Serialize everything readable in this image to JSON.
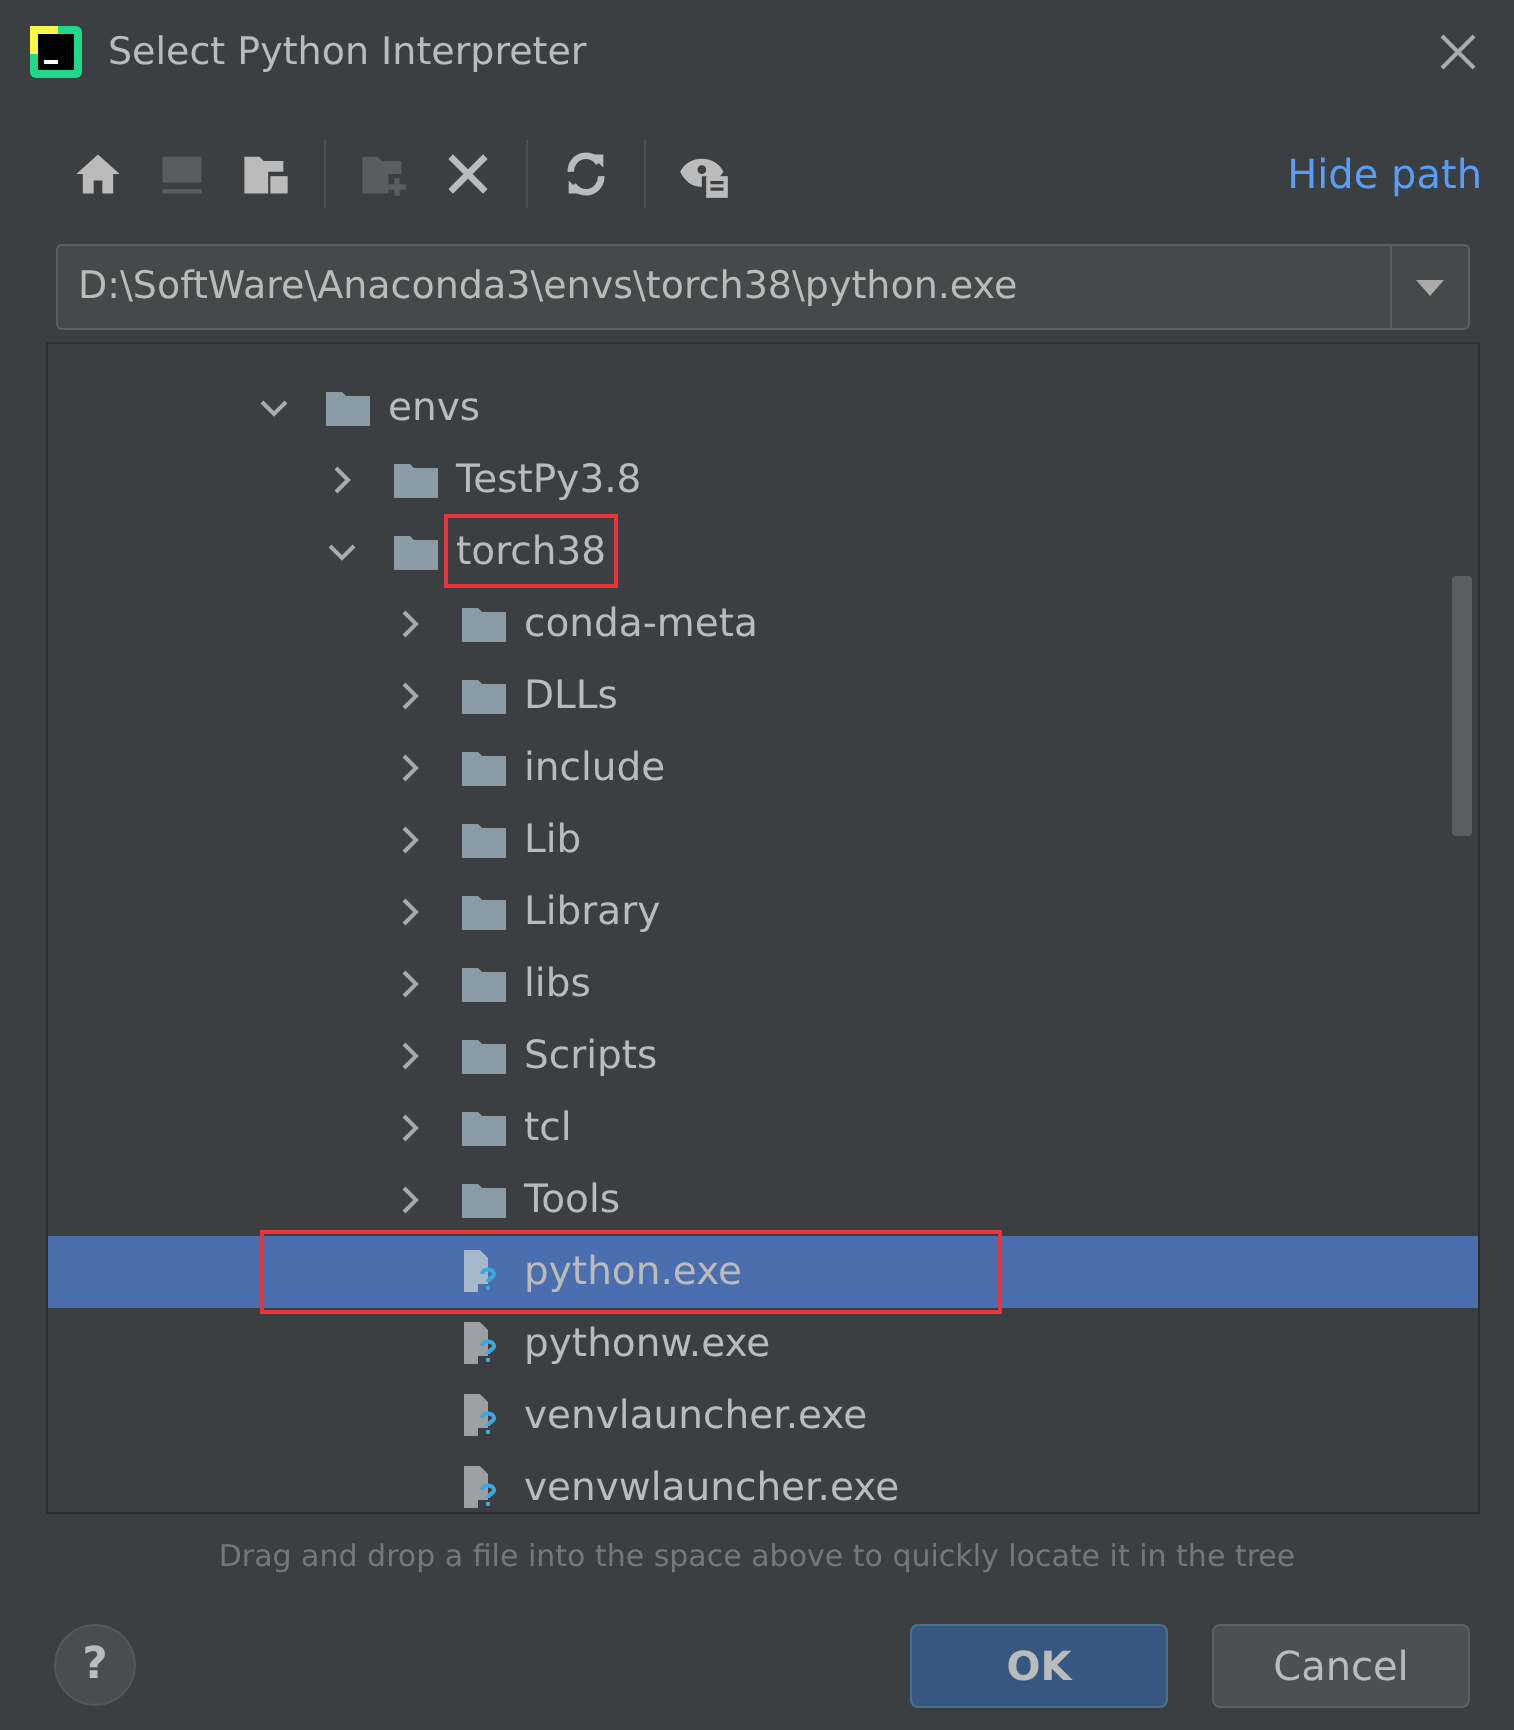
{
  "window": {
    "title": "Select Python Interpreter"
  },
  "toolbar": {
    "groups": [
      [
        {
          "kind": "home",
          "disabled": false
        },
        {
          "kind": "desktop",
          "disabled": true
        },
        {
          "kind": "project",
          "disabled": false
        }
      ],
      [
        {
          "kind": "new-folder",
          "disabled": true
        },
        {
          "kind": "delete",
          "disabled": false
        }
      ],
      [
        {
          "kind": "refresh",
          "disabled": false
        }
      ],
      [
        {
          "kind": "show-hidden",
          "disabled": false
        }
      ]
    ],
    "hide_path": "Hide path"
  },
  "path_field": {
    "value": "D:\\SoftWare\\Anaconda3\\envs\\torch38\\python.exe"
  },
  "tree": [
    {
      "label": "envs",
      "kind": "folder",
      "expanded": true,
      "selected": false,
      "highlighted": false,
      "children": [
        {
          "label": "TestPy3.8",
          "kind": "folder",
          "expanded": false,
          "selected": false,
          "highlighted": false
        },
        {
          "label": "torch38",
          "kind": "folder",
          "expanded": true,
          "selected": false,
          "highlighted": true,
          "children": [
            {
              "label": "conda-meta",
              "kind": "folder",
              "expanded": false,
              "selected": false,
              "highlighted": false
            },
            {
              "label": "DLLs",
              "kind": "folder",
              "expanded": false,
              "selected": false,
              "highlighted": false
            },
            {
              "label": "include",
              "kind": "folder",
              "expanded": false,
              "selected": false,
              "highlighted": false
            },
            {
              "label": "Lib",
              "kind": "folder",
              "expanded": false,
              "selected": false,
              "highlighted": false
            },
            {
              "label": "Library",
              "kind": "folder",
              "expanded": false,
              "selected": false,
              "highlighted": false
            },
            {
              "label": "libs",
              "kind": "folder",
              "expanded": false,
              "selected": false,
              "highlighted": false
            },
            {
              "label": "Scripts",
              "kind": "folder",
              "expanded": false,
              "selected": false,
              "highlighted": false
            },
            {
              "label": "tcl",
              "kind": "folder",
              "expanded": false,
              "selected": false,
              "highlighted": false
            },
            {
              "label": "Tools",
              "kind": "folder",
              "expanded": false,
              "selected": false,
              "highlighted": false
            },
            {
              "label": "python.exe",
              "kind": "file",
              "selected": true,
              "highlighted": true
            },
            {
              "label": "pythonw.exe",
              "kind": "file",
              "selected": false,
              "highlighted": false
            },
            {
              "label": "venvlauncher.exe",
              "kind": "file",
              "selected": false,
              "highlighted": false
            },
            {
              "label": "venvwlauncher.exe",
              "kind": "file",
              "selected": false,
              "highlighted": false
            }
          ]
        }
      ]
    }
  ],
  "hint": "Drag and drop a file into the space above to quickly locate it in the tree",
  "help": "?",
  "buttons": [
    {
      "label": "OK",
      "default": true
    },
    {
      "label": "Cancel",
      "default": false
    }
  ]
}
